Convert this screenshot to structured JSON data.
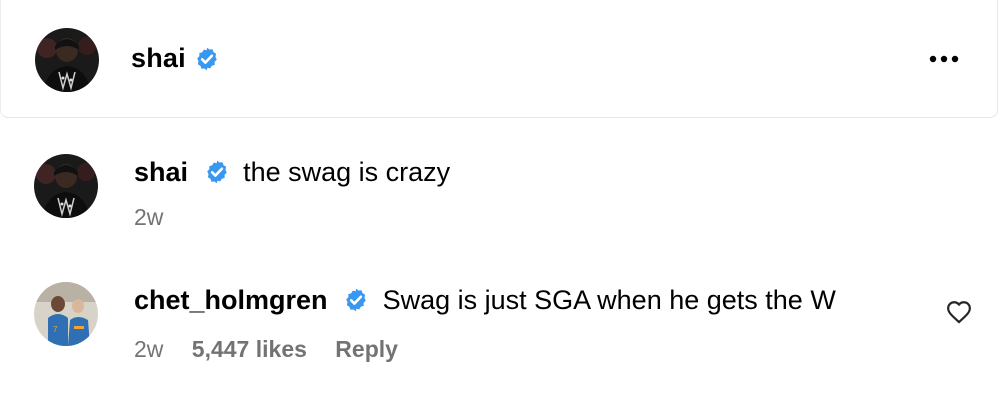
{
  "post": {
    "author": "shai",
    "author_verified": true,
    "more_icon": "more-horizontal-icon"
  },
  "comments": [
    {
      "username": "shai",
      "verified": true,
      "text": "the swag is crazy",
      "time": "2w"
    },
    {
      "username": "chet_holmgren",
      "verified": true,
      "text": "Swag is just SGA when he gets the W",
      "time": "2w",
      "likes": "5,447 likes",
      "reply": "Reply",
      "like_icon": "heart-icon"
    }
  ],
  "colors": {
    "verified_badge": "#3897f0",
    "meta_text": "#737373",
    "border": "#e6e6e6"
  }
}
